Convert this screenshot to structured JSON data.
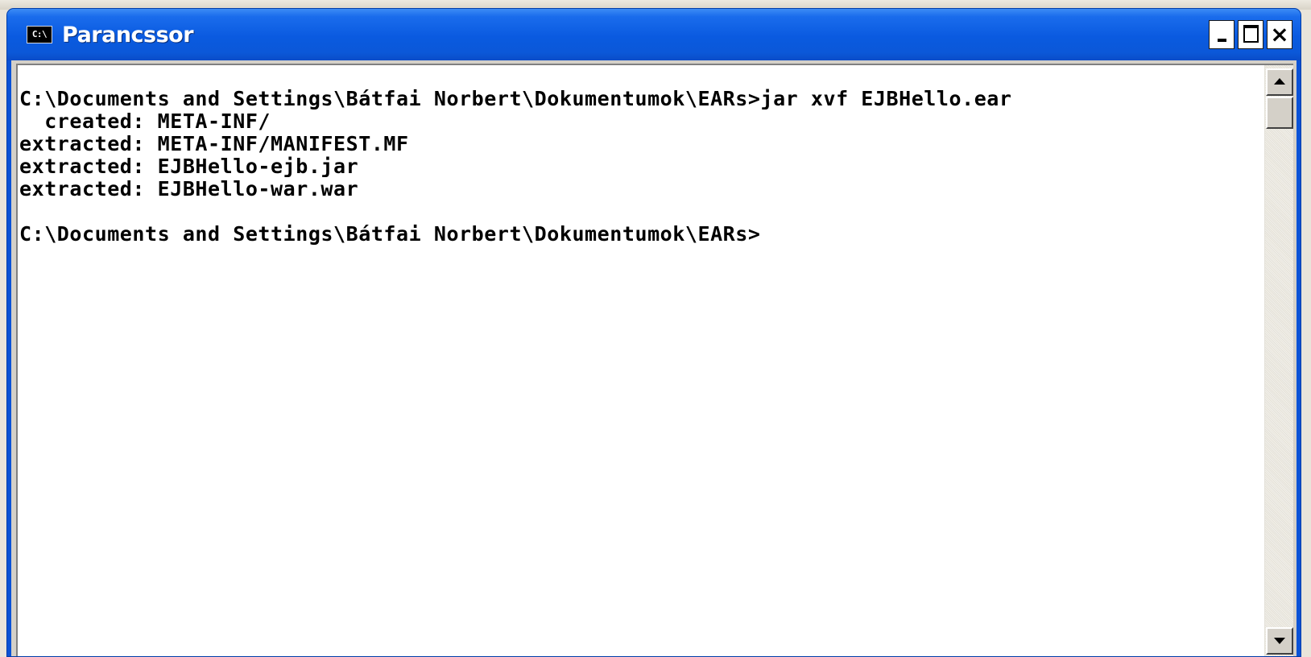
{
  "window": {
    "title": "Parancssor",
    "icon": "console-app-icon",
    "icon_text": "C:\\",
    "controls": {
      "minimize": "minimize-icon",
      "maximize": "maximize-icon",
      "close": "×"
    }
  },
  "console": {
    "lines": [
      "C:\\Documents and Settings\\Bátfai Norbert\\Dokumentumok\\EARs>jar xvf EJBHello.ear",
      "  created: META-INF/",
      "extracted: META-INF/MANIFEST.MF",
      "extracted: EJBHello-ejb.jar",
      "extracted: EJBHello-war.war",
      "",
      "C:\\Documents and Settings\\Bátfai Norbert\\Dokumentumok\\EARs>"
    ]
  },
  "colors": {
    "titlebar": "#0a5ae0",
    "console_background": "#ffffff",
    "console_text": "#000000"
  }
}
